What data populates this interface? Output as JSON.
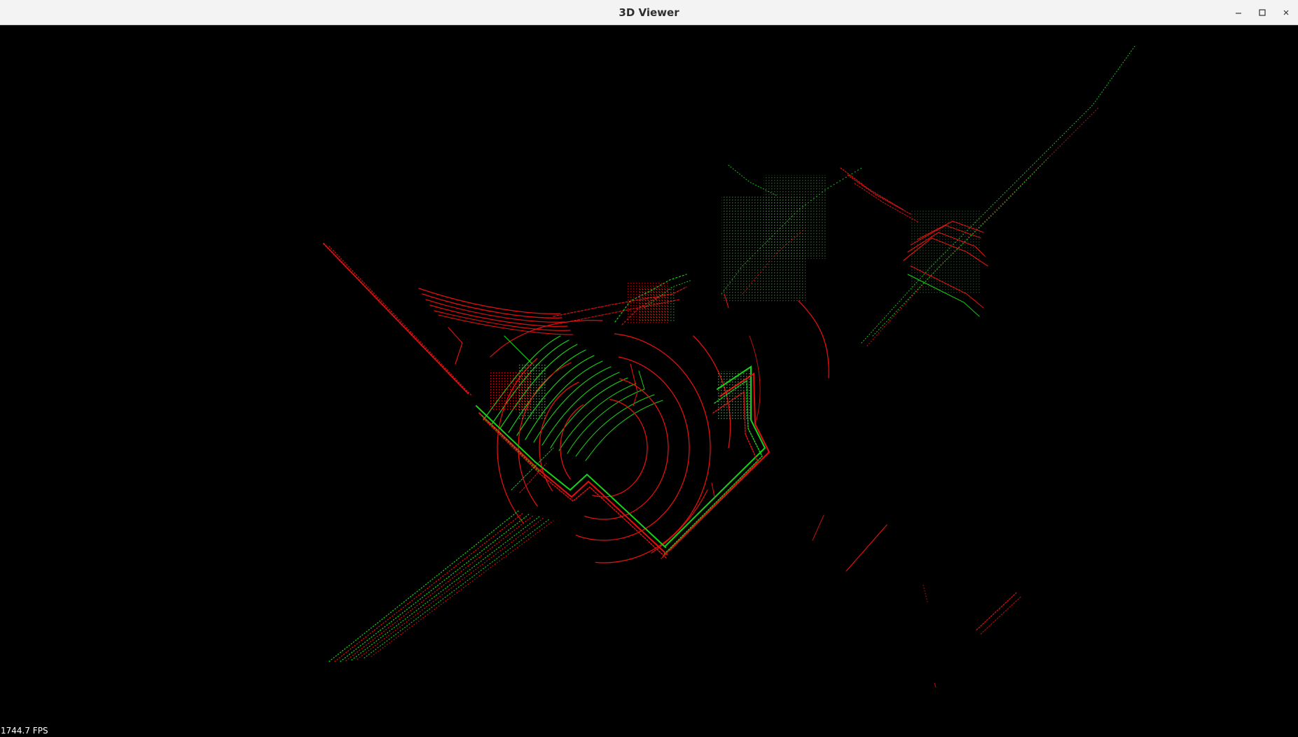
{
  "window": {
    "title": "3D Viewer",
    "buttons": [
      {
        "name": "minimize-button",
        "icon": "minimize-icon"
      },
      {
        "name": "maximize-button",
        "icon": "maximize-icon"
      },
      {
        "name": "close-button",
        "icon": "close-icon"
      }
    ]
  },
  "viewer": {
    "background": "#000000",
    "fps_label": "1744.7 FPS",
    "point_colors": {
      "primary": "#e01010",
      "secondary": "#18d018"
    }
  }
}
